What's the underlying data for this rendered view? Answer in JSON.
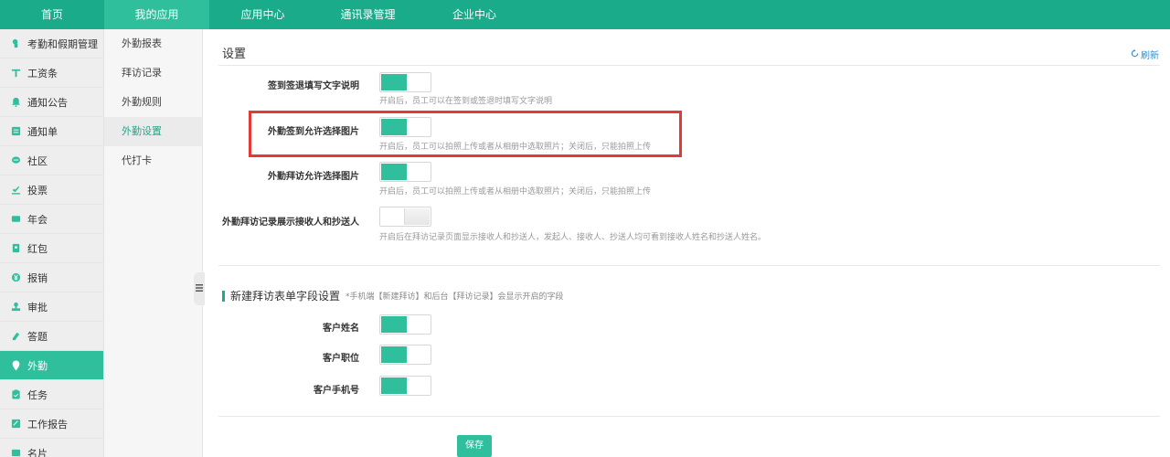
{
  "topnav": {
    "tabs": [
      {
        "label": "首页"
      },
      {
        "label": "我的应用"
      },
      {
        "label": "应用中心"
      },
      {
        "label": "通讯录管理"
      },
      {
        "label": "企业中心"
      }
    ]
  },
  "sidebar": {
    "items": [
      {
        "label": "考勤和假期管理",
        "icon": "clock-hand-icon"
      },
      {
        "label": "工资条",
        "icon": "salary-icon"
      },
      {
        "label": "通知公告",
        "icon": "bell-icon"
      },
      {
        "label": "通知单",
        "icon": "document-icon"
      },
      {
        "label": "社区",
        "icon": "chat-icon"
      },
      {
        "label": "投票",
        "icon": "vote-icon"
      },
      {
        "label": "年会",
        "icon": "card-icon"
      },
      {
        "label": "红包",
        "icon": "red-packet-icon"
      },
      {
        "label": "报销",
        "icon": "yen-icon"
      },
      {
        "label": "审批",
        "icon": "stamp-icon"
      },
      {
        "label": "答题",
        "icon": "quiz-icon"
      },
      {
        "label": "外勤",
        "icon": "location-pin-icon"
      },
      {
        "label": "任务",
        "icon": "clipboard-icon"
      },
      {
        "label": "工作报告",
        "icon": "report-icon"
      },
      {
        "label": "名片",
        "icon": "namecard-icon"
      }
    ]
  },
  "submenu": {
    "items": [
      {
        "label": "外勤报表"
      },
      {
        "label": "拜访记录"
      },
      {
        "label": "外勤规则"
      },
      {
        "label": "外勤设置"
      },
      {
        "label": "代打卡"
      }
    ]
  },
  "main": {
    "title": "设置",
    "refresh_label": "刷新",
    "settings": [
      {
        "label": "签到签退填写文字说明",
        "on": true,
        "hint": "开启后，员工可以在签到或签退时填写文字说明"
      },
      {
        "label": "外勤签到允许选择图片",
        "on": true,
        "hint": "开启后，员工可以拍照上传或者从相册中选取照片；关闭后，只能拍照上传"
      },
      {
        "label": "外勤拜访允许选择图片",
        "on": true,
        "hint": "开启后，员工可以拍照上传或者从相册中选取照片；关闭后，只能拍照上传"
      },
      {
        "label": "外勤拜访记录展示接收人和抄送人",
        "on": false,
        "hint": "开启后在拜访记录页面显示接收人和抄送人，发起人、接收人、抄送人均可看到接收人姓名和抄送人姓名。"
      }
    ],
    "section": {
      "title": "新建拜访表单字段设置",
      "note": "*手机端【新建拜访】和后台【拜访记录】会显示开启的字段"
    },
    "fields": [
      {
        "label": "客户姓名",
        "on": true
      },
      {
        "label": "客户职位",
        "on": true
      },
      {
        "label": "客户手机号",
        "on": true
      }
    ],
    "save_label": "保存"
  },
  "colors": {
    "accent": "#1aab8b",
    "toggle_on": "#2fbf9d",
    "highlight": "#e53935"
  }
}
